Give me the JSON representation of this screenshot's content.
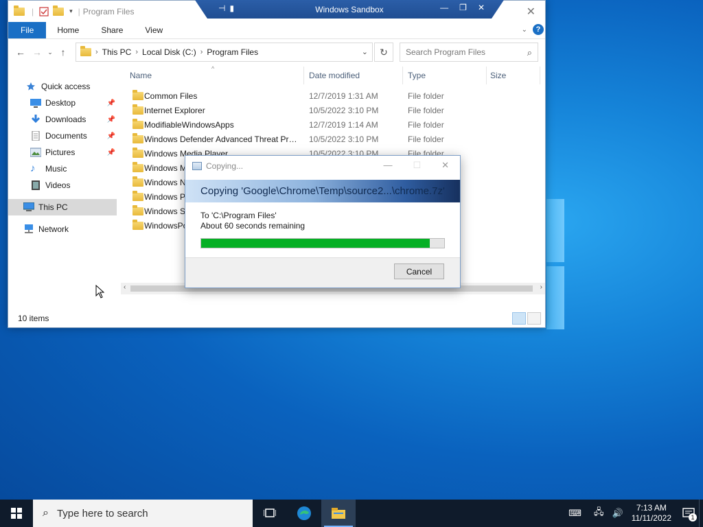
{
  "explorer": {
    "title": "Program Files",
    "ribbon_tabs": [
      "File",
      "Home",
      "Share",
      "View"
    ],
    "breadcrumbs": [
      "This PC",
      "Local Disk (C:)",
      "Program Files"
    ],
    "search_placeholder": "Search Program Files",
    "nav": [
      {
        "label": "Quick access",
        "icon": "star-icon",
        "pinned": false
      },
      {
        "label": "Desktop",
        "icon": "desktop-icon",
        "pinned": true
      },
      {
        "label": "Downloads",
        "icon": "download-icon",
        "pinned": true
      },
      {
        "label": "Documents",
        "icon": "document-icon",
        "pinned": true
      },
      {
        "label": "Pictures",
        "icon": "pictures-icon",
        "pinned": true
      },
      {
        "label": "Music",
        "icon": "music-icon",
        "pinned": false
      },
      {
        "label": "Videos",
        "icon": "video-icon",
        "pinned": false
      },
      {
        "label": "This PC",
        "icon": "computer-icon",
        "pinned": false
      },
      {
        "label": "Network",
        "icon": "network-icon",
        "pinned": false
      }
    ],
    "columns": [
      "Name",
      "Date modified",
      "Type",
      "Size"
    ],
    "files": [
      {
        "name": "Common Files",
        "date": "12/7/2019 1:31 AM",
        "type": "File folder"
      },
      {
        "name": "Internet Explorer",
        "date": "10/5/2022 3:10 PM",
        "type": "File folder"
      },
      {
        "name": "ModifiableWindowsApps",
        "date": "12/7/2019 1:14 AM",
        "type": "File folder"
      },
      {
        "name": "Windows Defender Advanced Threat Prot...",
        "date": "10/5/2022 3:10 PM",
        "type": "File folder"
      },
      {
        "name": "Windows Media Player",
        "date": "10/5/2022 3:10 PM",
        "type": "File folder"
      },
      {
        "name": "Windows M",
        "date": "",
        "type": ""
      },
      {
        "name": "Windows N",
        "date": "",
        "type": ""
      },
      {
        "name": "Windows P",
        "date": "",
        "type": ""
      },
      {
        "name": "Windows Se",
        "date": "",
        "type": ""
      },
      {
        "name": "WindowsPo",
        "date": "",
        "type": ""
      }
    ],
    "status": "10 items"
  },
  "sandbox": {
    "title": "Windows Sandbox"
  },
  "copy_dialog": {
    "title": "Copying...",
    "heading": "Copying 'Google\\Chrome\\Temp\\source2...\\chrome.7z'",
    "destination": "To 'C:\\Program Files'",
    "remaining": "About 60 seconds remaining",
    "progress_percent": 94,
    "cancel_label": "Cancel"
  },
  "taskbar": {
    "search_placeholder": "Type here to search",
    "time": "7:13 AM",
    "date": "11/11/2022",
    "notification_count": "1"
  },
  "colors": {
    "accent": "#1a6fc5",
    "progress": "#06b025",
    "taskbar": "#0f1b2b"
  }
}
